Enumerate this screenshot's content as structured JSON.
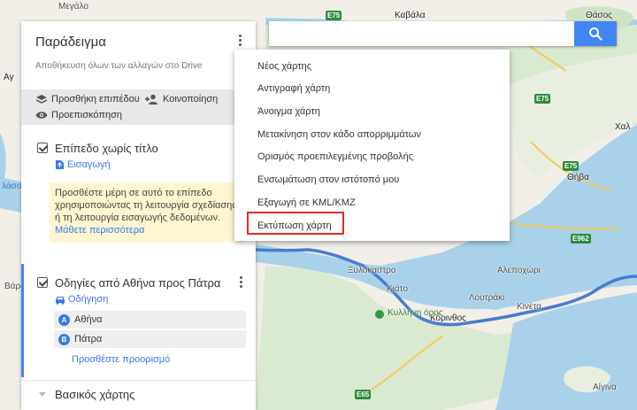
{
  "panel": {
    "title": "Παράδειγμα",
    "autosave": "Αποθήκευση όλων των αλλαγών στο Drive",
    "toolbar": {
      "add_layer": "Προσθήκη επιπέδου",
      "share": "Κοινοποίηση",
      "preview": "Προεπισκόπηση"
    },
    "layer1": {
      "title": "Επίπεδο χωρίς τίτλο",
      "import_link": "Εισαγωγή",
      "tip_text": "Προσθέστε μέρη σε αυτό το επίπεδο χρησιμοποιώντας τη λειτουργία σχεδίασης ή τη λειτουργία εισαγωγής δεδομένων.",
      "learn_more": "Μάθετε περισσότερα"
    },
    "directions": {
      "title": "Οδηγίες από Αθήνα προς Πάτρα",
      "mode": "Οδήγηση",
      "waypoints": [
        {
          "badge": "A",
          "label": "Αθήνα"
        },
        {
          "badge": "B",
          "label": "Πάτρα"
        }
      ],
      "add_destination": "Προσθέστε προορισμό"
    },
    "basemap": "Βασικός χάρτης"
  },
  "search": {
    "value": "",
    "placeholder": ""
  },
  "menu": {
    "items": [
      "Νέος χάρτης",
      "Αντιγραφή χάρτη",
      "Άνοιγμα χάρτη",
      "Μετακίνηση στον κάδο απορριμμάτων",
      "Ορισμός προεπιλεγμένης προβολής",
      "Ενσωμάτωση στον ιστότοπό μου",
      "Εξαγωγή σε KML/KMZ",
      "Εκτύπωση χάρτη"
    ],
    "highlighted_index": 7
  },
  "map": {
    "labels": {
      "megalo": "Μεγάλο",
      "kavala": "Καβάλα",
      "thasos": "Θάσος",
      "agios": "Αγ",
      "chalkida": "Χαλ",
      "thiva": "Θήβα",
      "xylokastro": "Ξυλόκαστρο",
      "kiato": "Κιάτο",
      "alepochori": "Αλεποχώρι",
      "korinthos": "Κόρινθος",
      "loutraki": "Λουτράκι",
      "kineta": "Κινέτα",
      "aigina": "Αίγινα",
      "varda": "Βάρδ",
      "kyllini": "Κυλλήνη όρος",
      "sea_left": "λάσσ"
    },
    "road_shields": [
      "E75",
      "E75",
      "E75",
      "E962",
      "E65"
    ],
    "colors": {
      "sea": "#a9d2ea",
      "land": "#f2efe9",
      "route": "#4a7bd0",
      "highlight": "#e12a2a",
      "accent": "#4285f4"
    }
  },
  "icons": [
    "search-icon",
    "kebab-icon",
    "layers-icon",
    "add-person-icon",
    "eye-icon",
    "import-icon",
    "car-icon",
    "chevron-down-icon"
  ]
}
